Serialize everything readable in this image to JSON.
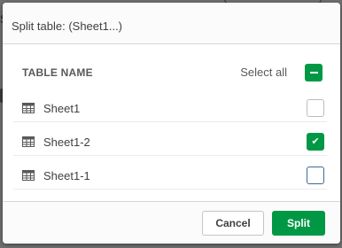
{
  "dialog": {
    "title": "Split table: (Sheet1...)",
    "column_header": "TABLE NAME",
    "select_all_label": "Select all",
    "select_all_state": "indeterminate",
    "rows": [
      {
        "name": "Sheet1",
        "checked": false
      },
      {
        "name": "Sheet1-2",
        "checked": true
      },
      {
        "name": "Sheet1-1",
        "checked": false
      }
    ],
    "cancel_label": "Cancel",
    "confirm_label": "Split"
  },
  "colors": {
    "accent": "#009845",
    "focus": "#3a6b95"
  },
  "icons": {
    "table": "table-icon",
    "check": "check-icon",
    "minus": "minus-icon"
  }
}
